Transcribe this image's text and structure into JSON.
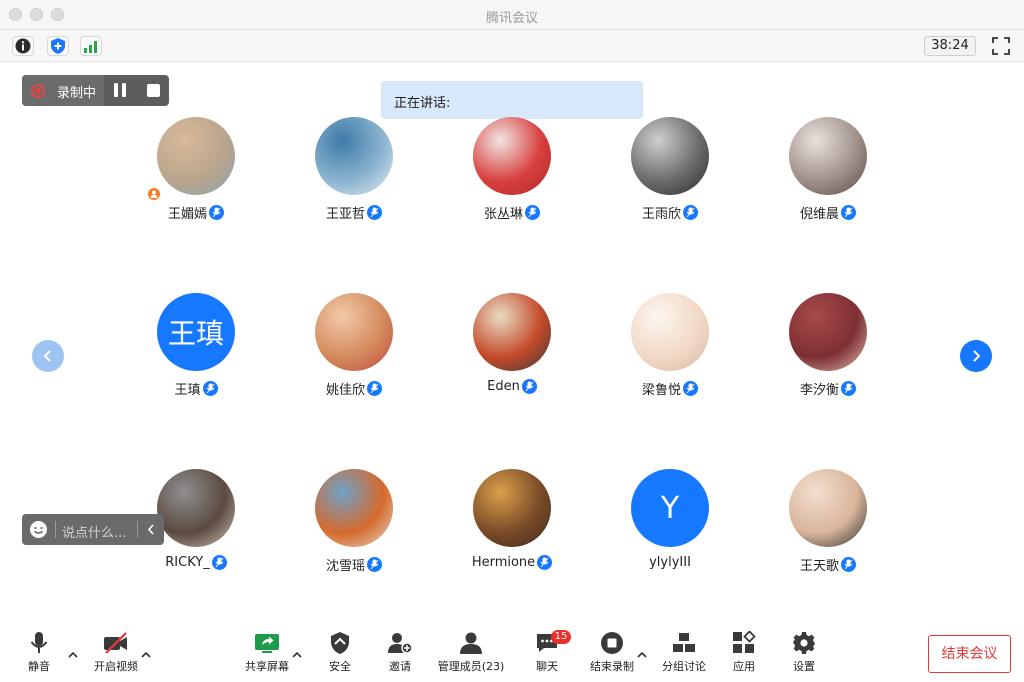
{
  "window": {
    "title": "腾讯会议"
  },
  "statusbar": {
    "timer": "38:24",
    "icons": [
      "info-icon",
      "security-shield-icon",
      "network-signal-icon"
    ]
  },
  "recording": {
    "label": "录制中"
  },
  "speaking": {
    "label": "正在讲话:"
  },
  "participants": [
    {
      "name": "王媚嫣",
      "host": true,
      "avatar": "photo",
      "bg": [
        "#d9b99a",
        "#b9a58c",
        "#8aa2b0"
      ]
    },
    {
      "name": "王亚哲",
      "avatar": "photo",
      "bg": [
        "#3e7aa8",
        "#8ab4cf",
        "#e8eef2"
      ]
    },
    {
      "name": "张丛琳",
      "avatar": "photo",
      "bg": [
        "#f0e6e2",
        "#d8403e",
        "#b1262a"
      ]
    },
    {
      "name": "王雨欣",
      "avatar": "photo",
      "bg": [
        "#cfcfcf",
        "#6b6b6b",
        "#2a2a2a"
      ]
    },
    {
      "name": "倪维晨",
      "avatar": "photo",
      "bg": [
        "#e8e2dc",
        "#a0908a",
        "#5a4a45"
      ]
    },
    {
      "name": "王瑱",
      "avatar": "letter",
      "letter": "王瑱"
    },
    {
      "name": "姚佳欣",
      "avatar": "photo",
      "bg": [
        "#f2c9a8",
        "#d48b5e",
        "#c2463e"
      ]
    },
    {
      "name": "Eden",
      "avatar": "photo",
      "bg": [
        "#e9dcc3",
        "#c44a2a",
        "#3a3a3a"
      ]
    },
    {
      "name": "梁鲁悦",
      "avatar": "photo",
      "bg": [
        "#fbf6ee",
        "#f2d9c7",
        "#d8b8a0"
      ]
    },
    {
      "name": "李汐衡",
      "avatar": "photo",
      "bg": [
        "#a84a4a",
        "#7e2f33",
        "#e2c2b0"
      ]
    },
    {
      "name": "RICKY_",
      "avatar": "photo",
      "bg": [
        "#8f8f8f",
        "#5a4a40",
        "#d3c2b5"
      ]
    },
    {
      "name": "沈雪瑶",
      "avatar": "photo",
      "bg": [
        "#6fa2c8",
        "#d5692e",
        "#e6e1c7"
      ]
    },
    {
      "name": "Hermione",
      "avatar": "photo",
      "bg": [
        "#d9a04a",
        "#7a4a28",
        "#3a2a1e"
      ]
    },
    {
      "name": "ylylyIII",
      "avatar": "letter",
      "letter": "Y",
      "no_mic": true
    },
    {
      "name": "王天歌",
      "avatar": "photo",
      "bg": [
        "#f3e0d0",
        "#d8b49a",
        "#2c2c2c"
      ]
    }
  ],
  "chat": {
    "placeholder": "说点什么..."
  },
  "toolbar": {
    "mute": "静音",
    "video": "开启视频",
    "share": "共享屏幕",
    "security": "安全",
    "invite": "邀请",
    "members": "管理成员(23)",
    "chat": "聊天",
    "chat_count": "15",
    "end_record": "结束录制",
    "breakout": "分组讨论",
    "apps": "应用",
    "settings": "设置"
  },
  "end_meeting": "结束会议",
  "colors": {
    "accent": "#1677ff",
    "danger": "#e63838",
    "recording": "#ee3d3d"
  }
}
